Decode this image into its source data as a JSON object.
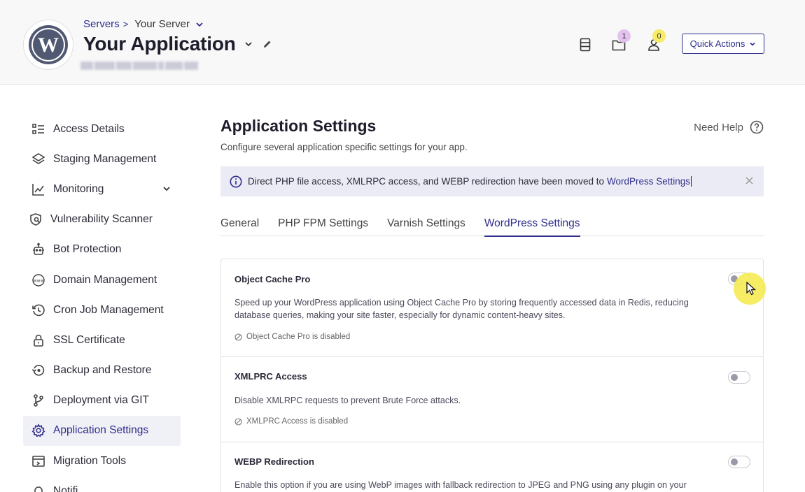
{
  "header": {
    "breadcrumb_servers": "Servers",
    "breadcrumb_sep": ">",
    "breadcrumb_server": "Your Server",
    "app_title": "Your Application",
    "notifications_badge": "1",
    "team_badge": "0",
    "quick_actions_label": "Quick Actions"
  },
  "sidebar": {
    "items": [
      {
        "label": "Access Details",
        "icon": "access-details-icon"
      },
      {
        "label": "Staging Management",
        "icon": "layers-icon"
      },
      {
        "label": "Monitoring",
        "icon": "chart-line-icon"
      },
      {
        "label": "Vulnerability Scanner",
        "icon": "shield-scan-icon"
      },
      {
        "label": "Bot Protection",
        "icon": "robot-icon"
      },
      {
        "label": "Domain Management",
        "icon": "www-icon"
      },
      {
        "label": "Cron Job Management",
        "icon": "history-icon"
      },
      {
        "label": "SSL Certificate",
        "icon": "lock-icon"
      },
      {
        "label": "Backup and Restore",
        "icon": "restore-icon"
      },
      {
        "label": "Deployment via GIT",
        "icon": "git-branch-icon"
      },
      {
        "label": "Application Settings",
        "icon": "gear-icon"
      },
      {
        "label": "Migration Tools",
        "icon": "migration-icon"
      },
      {
        "label": "Notifi...",
        "icon": "bell-icon"
      }
    ],
    "active": "Application Settings"
  },
  "main": {
    "title": "Application Settings",
    "subtitle": "Configure several application specific settings for your app.",
    "need_help": "Need Help",
    "banner_text": "Direct PHP file access, XMLRPC access, and WEBP redirection have been moved to",
    "banner_link": "WordPress Settings",
    "tabs": [
      {
        "label": "General"
      },
      {
        "label": "PHP FPM Settings"
      },
      {
        "label": "Varnish Settings"
      },
      {
        "label": "WordPress Settings"
      }
    ],
    "active_tab": "WordPress Settings",
    "cards": [
      {
        "title": "Object Cache Pro",
        "description": "Speed up your WordPress application using Object Cache Pro by storing frequently accessed data in Redis, reducing database queries, making your site faster, especially for dynamic content-heavy sites.",
        "status": "Object Cache Pro is disabled",
        "enabled": false
      },
      {
        "title": "XMLPRC Access",
        "description": "Disable XMLRPC requests to prevent Brute Force attacks.",
        "status": "XMLPRC Access is disabled",
        "enabled": false
      },
      {
        "title": "WEBP Redirection",
        "description": "Enable this option if you are using WebP images with fallback redirection to JPEG and PNG using any plugin on your",
        "enabled": false
      }
    ]
  },
  "colors": {
    "accent": "#2f2e8b",
    "banner_bg": "#ebebf6",
    "notif_badge": "#e3c3ee",
    "team_badge": "#f6ea66"
  }
}
